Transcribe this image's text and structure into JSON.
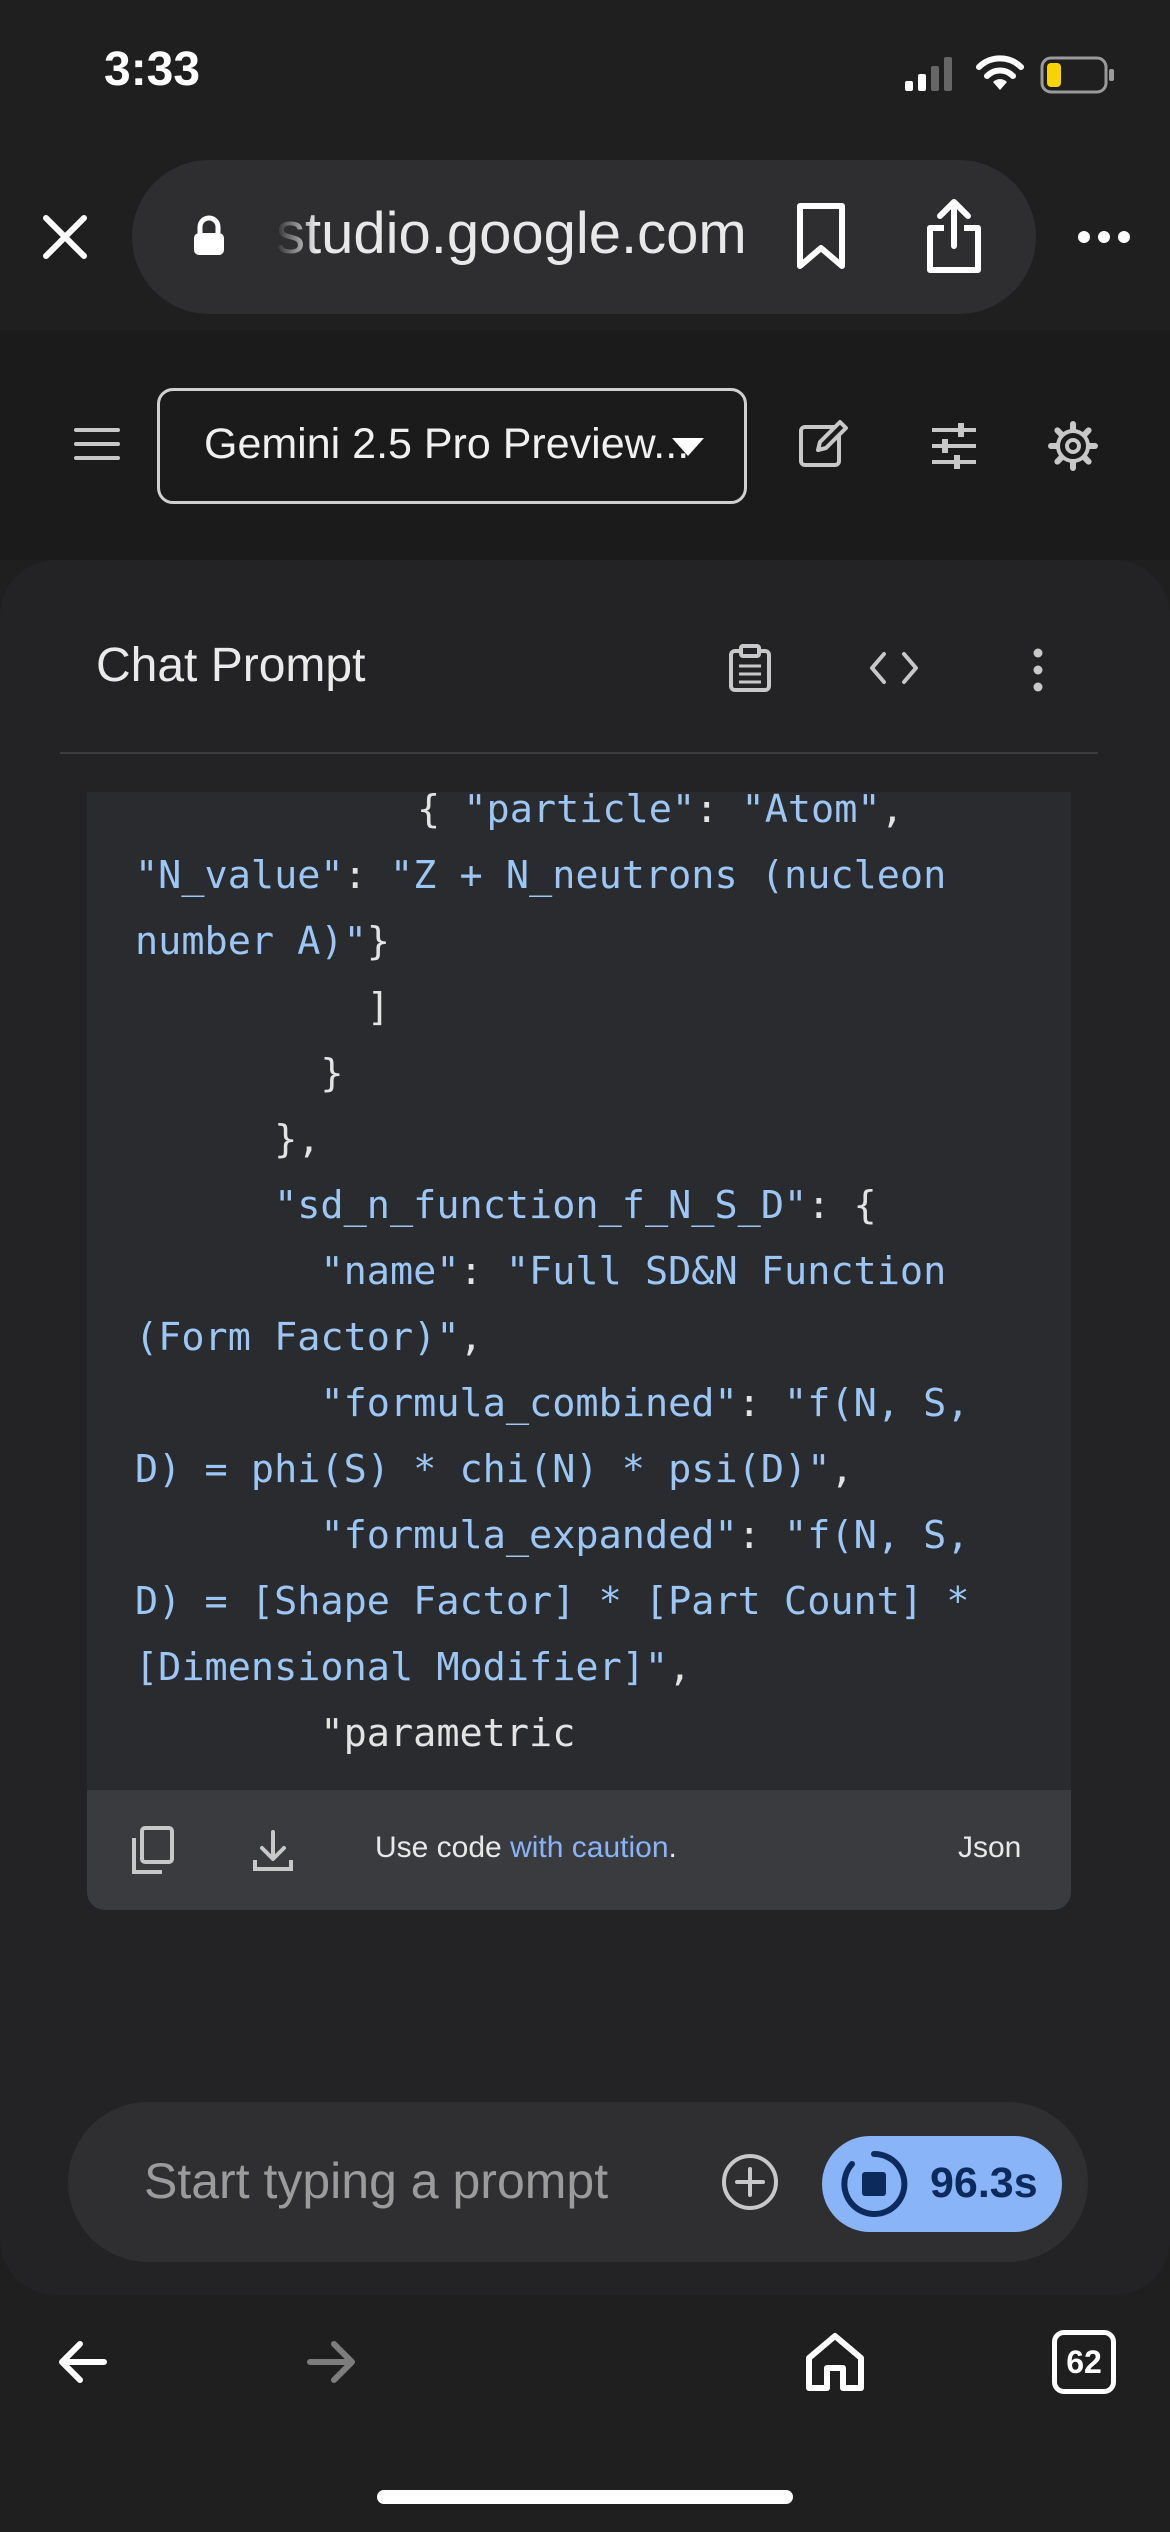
{
  "status_bar": {
    "time": "3:33"
  },
  "browser": {
    "url": "studio.google.com",
    "tab_count": "62"
  },
  "toolbar": {
    "model_name": "Gemini 2.5 Pro Preview..."
  },
  "chat": {
    "title": "Chat Prompt"
  },
  "code": {
    "lines": [
      [
        {
          "t": "{ ",
          "c": "pun"
        },
        {
          "t": "\"particle\"",
          "c": "str"
        },
        {
          "t": ": ",
          "c": "pun"
        },
        {
          "t": "\"Atom\"",
          "c": "str"
        },
        {
          "t": ",",
          "c": "pun"
        }
      ],
      [
        {
          "t": "\"N_value\"",
          "c": "str"
        },
        {
          "t": ": ",
          "c": "pun"
        },
        {
          "t": "\"Z + N_neutrons (nucleon",
          "c": "str"
        }
      ],
      [
        {
          "t": "number A)\"",
          "c": "str"
        },
        {
          "t": "}",
          "c": "pun"
        }
      ],
      [
        {
          "t": "          ]",
          "c": "pun"
        }
      ],
      [
        {
          "t": "        }",
          "c": "pun"
        }
      ],
      [
        {
          "t": "      },",
          "c": "pun"
        }
      ],
      [
        {
          "t": "      ",
          "c": "pun"
        },
        {
          "t": "\"sd_n_function_f_N_S_D\"",
          "c": "str"
        },
        {
          "t": ": {",
          "c": "pun"
        }
      ],
      [
        {
          "t": "        ",
          "c": "pun"
        },
        {
          "t": "\"name\"",
          "c": "str"
        },
        {
          "t": ": ",
          "c": "pun"
        },
        {
          "t": "\"Full SD&N Function",
          "c": "str"
        }
      ],
      [
        {
          "t": "(Form Factor)\"",
          "c": "str"
        },
        {
          "t": ",",
          "c": "pun"
        }
      ],
      [
        {
          "t": "        ",
          "c": "pun"
        },
        {
          "t": "\"formula_combined\"",
          "c": "str"
        },
        {
          "t": ": ",
          "c": "pun"
        },
        {
          "t": "\"f(N, S,",
          "c": "str"
        }
      ],
      [
        {
          "t": "D) = phi(S) * chi(N) * psi(D)\"",
          "c": "str"
        },
        {
          "t": ",",
          "c": "pun"
        }
      ],
      [
        {
          "t": "        ",
          "c": "pun"
        },
        {
          "t": "\"formula_expanded\"",
          "c": "str"
        },
        {
          "t": ": ",
          "c": "pun"
        },
        {
          "t": "\"f(N, S,",
          "c": "str"
        }
      ],
      [
        {
          "t": "D) = [Shape Factor] * [Part Count] *",
          "c": "str"
        }
      ],
      [
        {
          "t": "[Dimensional Modifier]\"",
          "c": "str"
        },
        {
          "t": ",",
          "c": "pun"
        }
      ],
      [
        {
          "t": "        \"parametric",
          "c": "pun"
        }
      ]
    ],
    "footer": {
      "caution_prefix": "Use code ",
      "caution_link": "with caution",
      "caution_suffix": ".",
      "language": "Json"
    }
  },
  "prompt": {
    "placeholder": "Start typing a prompt",
    "run_timer": "96.3s"
  },
  "colors": {
    "accent": "#8ab4f8",
    "code_string": "#9cc6f5",
    "background": "#1f1f20"
  }
}
